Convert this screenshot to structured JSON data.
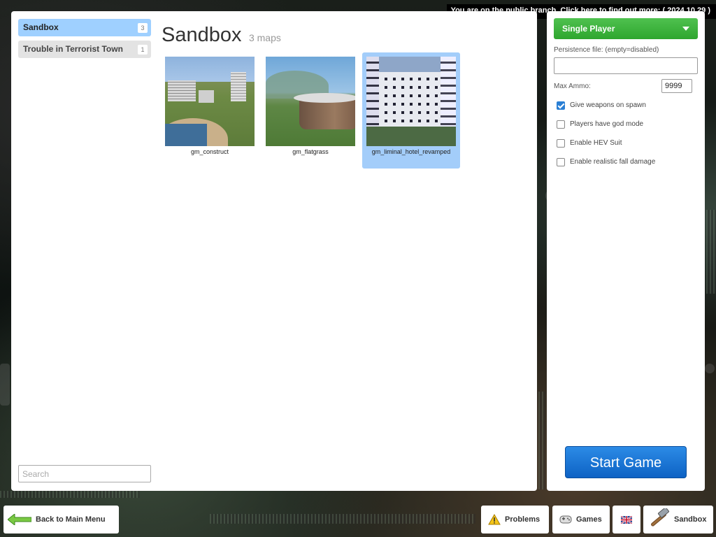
{
  "banner": {
    "text": "You are on the public branch. Click here to find out more: ( 2024.10.29 )"
  },
  "categories": [
    {
      "label": "Sandbox",
      "count": "3",
      "active": true
    },
    {
      "label": "Trouble in Terrorist Town",
      "count": "1",
      "active": false
    }
  ],
  "search": {
    "placeholder": "Search",
    "value": ""
  },
  "heading": {
    "title": "Sandbox",
    "subtitle": "3 maps"
  },
  "maps": [
    {
      "name": "gm_construct",
      "selected": false
    },
    {
      "name": "gm_flatgrass",
      "selected": false
    },
    {
      "name": "gm_liminal_hotel_revamped",
      "selected": true
    }
  ],
  "settings": {
    "mode": "Single Player",
    "persistence_label": "Persistence file: (empty=disabled)",
    "persistence_value": "",
    "max_ammo_label": "Max Ammo:",
    "max_ammo_value": "9999",
    "checkboxes": [
      {
        "label": "Give weapons on spawn",
        "checked": true
      },
      {
        "label": "Players have god mode",
        "checked": false
      },
      {
        "label": "Enable HEV Suit",
        "checked": false
      },
      {
        "label": "Enable realistic fall damage",
        "checked": false
      }
    ],
    "start_label": "Start Game"
  },
  "bottom_bar": {
    "back_label": "Back to Main Menu",
    "problems_label": "Problems",
    "games_label": "Games",
    "sandbox_label": "Sandbox",
    "icons": [
      "arrow-left-icon",
      "warning-icon",
      "gamepad-icon",
      "flag-uk-icon",
      "hammer-icon"
    ]
  },
  "colors": {
    "accent_blue": "#9fd0ff",
    "start_button": "#1a78d8",
    "mode_green": "#3cb43c"
  }
}
